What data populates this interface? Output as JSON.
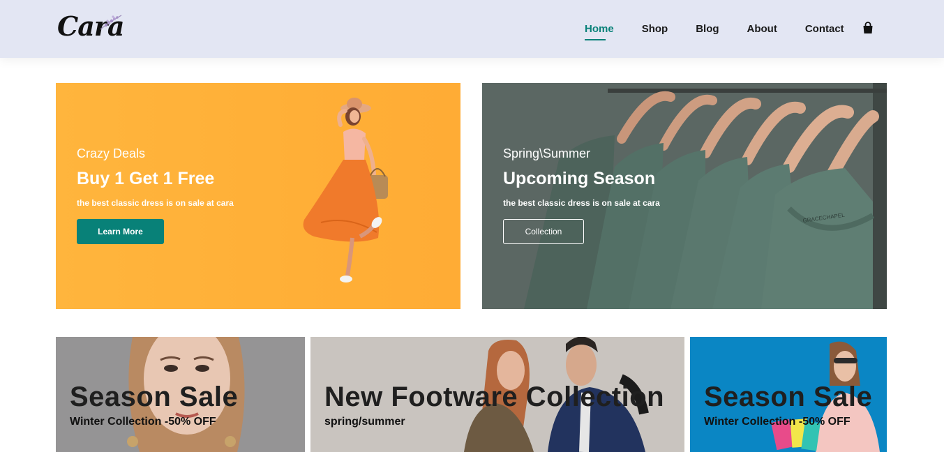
{
  "brand": {
    "logo_text": "Cara"
  },
  "nav": {
    "items": [
      {
        "label": "Home",
        "active": true
      },
      {
        "label": "Shop"
      },
      {
        "label": "Blog"
      },
      {
        "label": "About"
      },
      {
        "label": "Contact"
      }
    ],
    "cart_icon": "shopping-bag-icon"
  },
  "colors": {
    "accent": "#088178",
    "header_bg": "#e3e6f3",
    "orange_banner": "#ffb53d",
    "green_banner": "#5f6b67",
    "blue_banner": "#0a86c4"
  },
  "banners": {
    "deals": {
      "subtitle": "Crazy Deals",
      "title": "Buy 1 Get 1 Free",
      "description": "the best classic dress is on sale at cara",
      "button": "Learn More"
    },
    "season": {
      "subtitle": "Spring\\Summer",
      "title": "Upcoming Season",
      "description": "the best classic dress is on sale at cara",
      "button": "Collection"
    }
  },
  "small_banners": [
    {
      "title": "Season Sale",
      "subtitle": "Winter Collection -50% OFF"
    },
    {
      "title": "New Footware Collection",
      "subtitle": "spring/summer"
    },
    {
      "title": "Season Sale",
      "subtitle": "Winter Collection -50% OFF"
    }
  ]
}
